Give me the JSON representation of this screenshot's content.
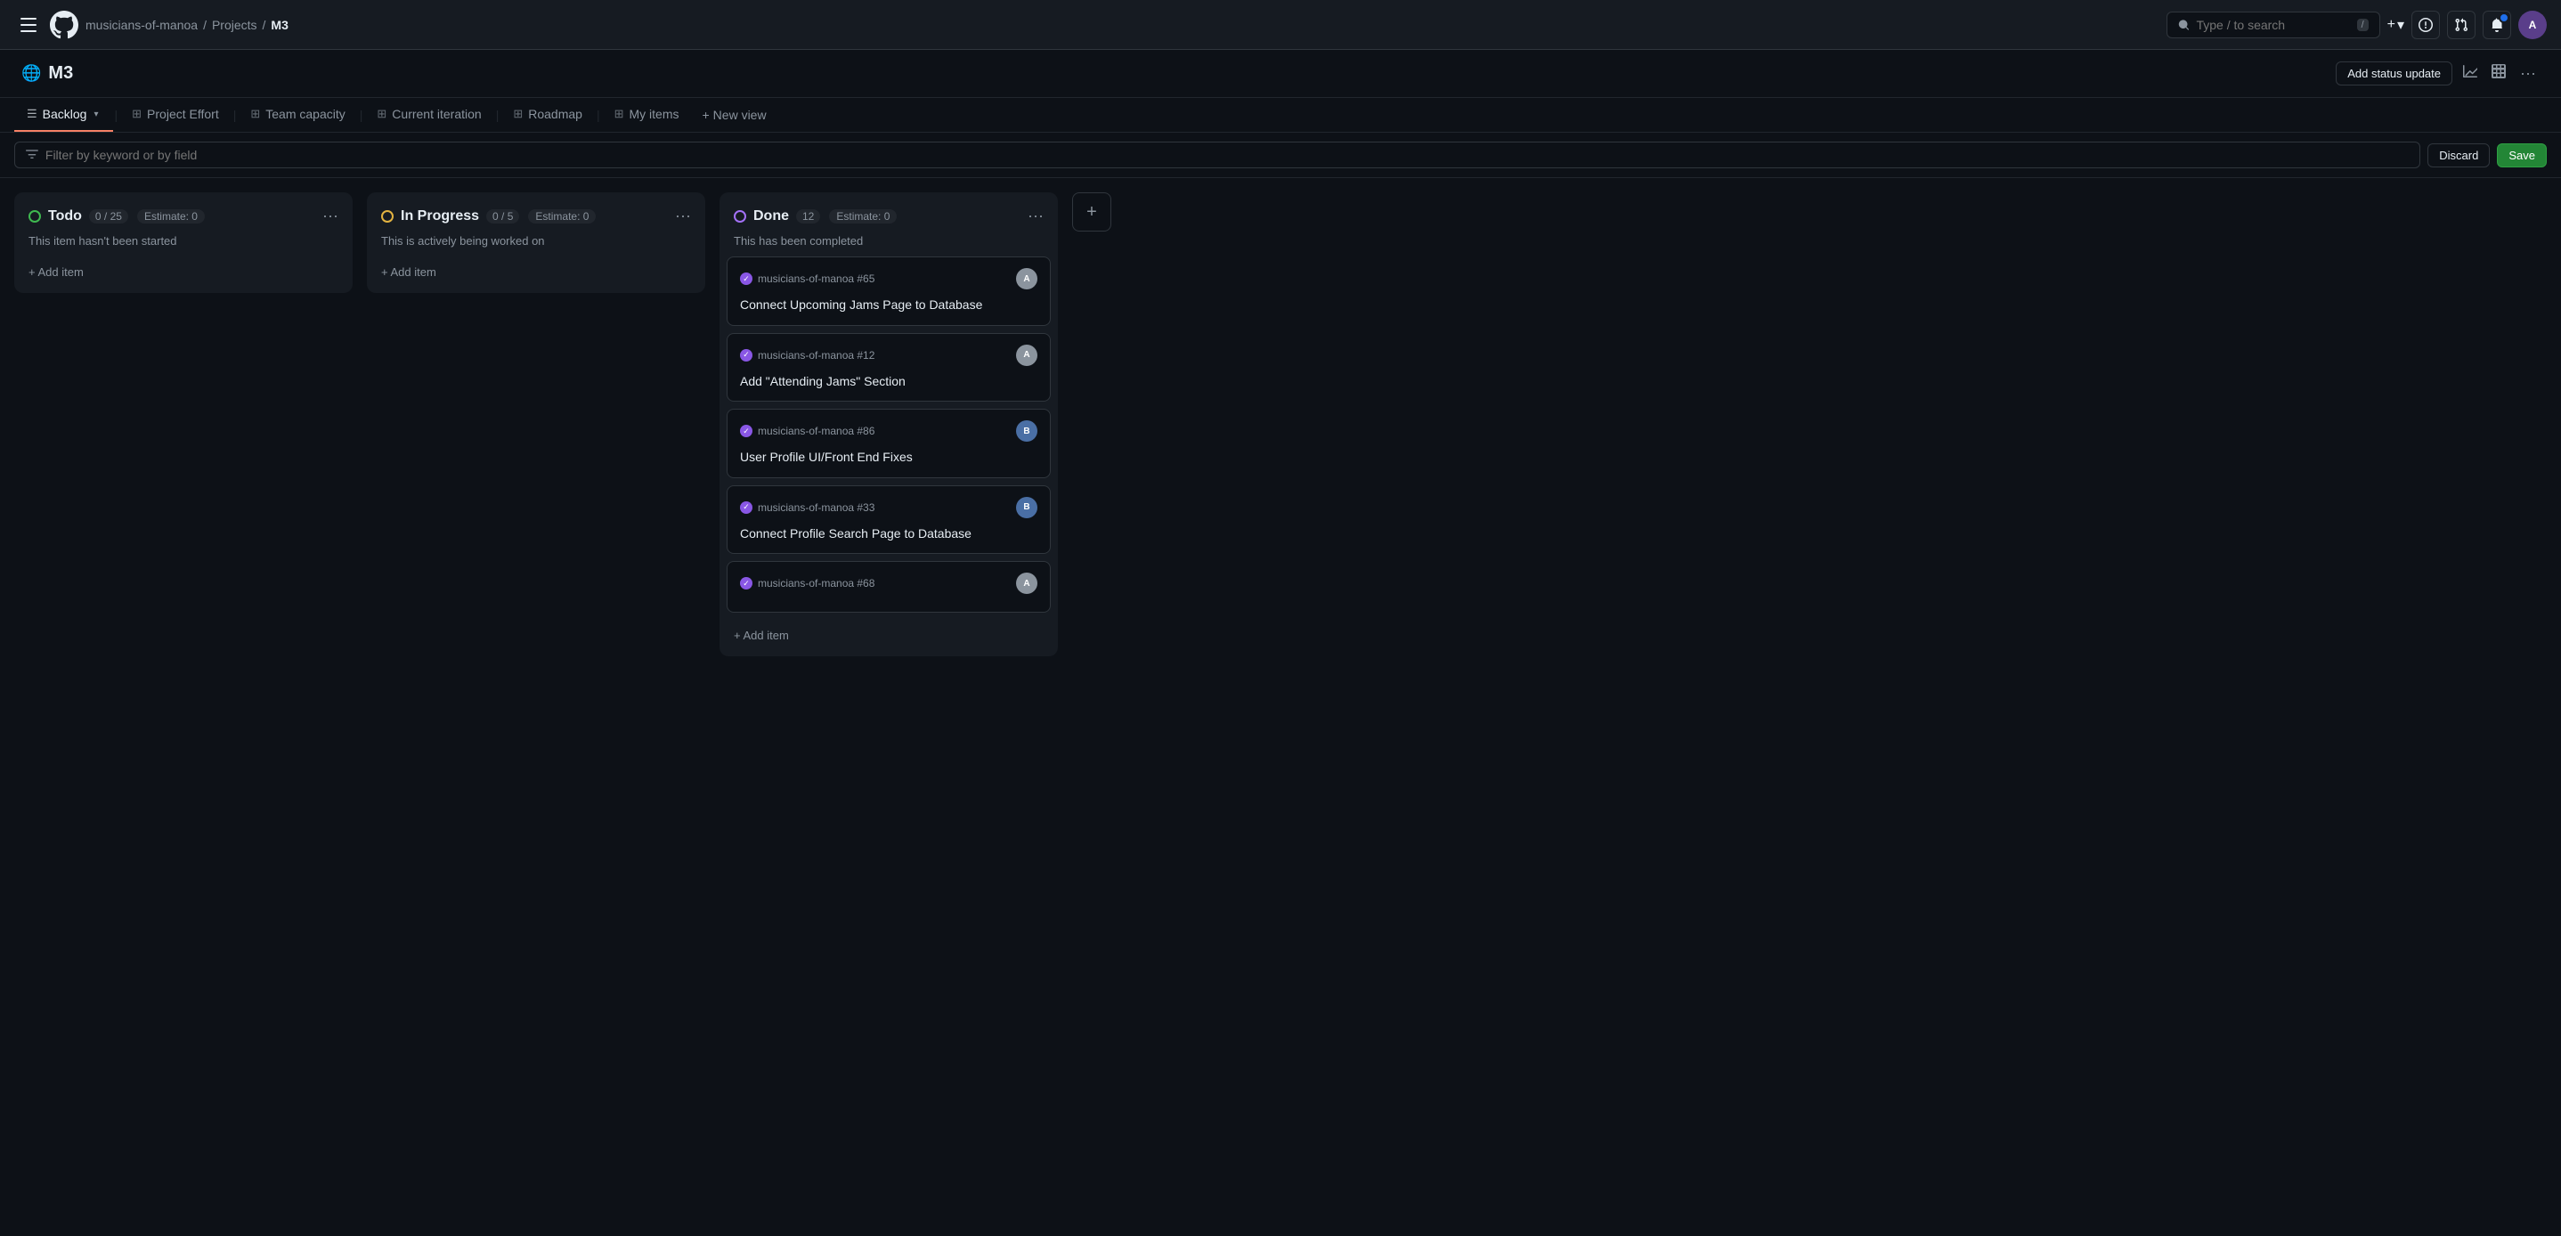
{
  "nav": {
    "breadcrumb": {
      "org": "musicians-of-manoa",
      "projects": "Projects",
      "current": "M3"
    },
    "search_placeholder": "Type / to search",
    "plus_label": "+",
    "chevron_label": "▾"
  },
  "project": {
    "title": "M3",
    "status_update_label": "Add status update"
  },
  "tabs": [
    {
      "id": "backlog",
      "label": "Backlog",
      "active": true,
      "icon": "☰"
    },
    {
      "id": "project-effort",
      "label": "Project Effort",
      "active": false,
      "icon": "⊞"
    },
    {
      "id": "team-capacity",
      "label": "Team capacity",
      "active": false,
      "icon": "⊞"
    },
    {
      "id": "current-iteration",
      "label": "Current iteration",
      "active": false,
      "icon": "⊞"
    },
    {
      "id": "roadmap",
      "label": "Roadmap",
      "active": false,
      "icon": "⊞"
    },
    {
      "id": "my-items",
      "label": "My items",
      "active": false,
      "icon": "⊞"
    }
  ],
  "new_view_label": "New view",
  "filter": {
    "placeholder": "Filter by keyword or by field",
    "discard_label": "Discard",
    "save_label": "Save"
  },
  "columns": [
    {
      "id": "todo",
      "title": "Todo",
      "status": "todo",
      "count": "0 / 25",
      "estimate": "Estimate: 0",
      "description": "This item hasn't been started",
      "cards": []
    },
    {
      "id": "in-progress",
      "title": "In Progress",
      "status": "in-progress",
      "count": "0 / 5",
      "estimate": "Estimate: 0",
      "description": "This is actively being worked on",
      "cards": []
    },
    {
      "id": "done",
      "title": "Done",
      "status": "done",
      "count": "12",
      "estimate": "Estimate: 0",
      "description": "This has been completed",
      "cards": [
        {
          "id": "card-65",
          "repo": "musicians-of-manoa #65",
          "title": "Connect Upcoming Jams Page to Database",
          "avatar_color": "#8b949e",
          "avatar_initials": "A"
        },
        {
          "id": "card-12",
          "repo": "musicians-of-manoa #12",
          "title": "Add \"Attending Jams\" Section",
          "avatar_color": "#8b949e",
          "avatar_initials": "A"
        },
        {
          "id": "card-86",
          "repo": "musicians-of-manoa #86",
          "title": "User Profile UI/Front End Fixes",
          "avatar_color": "#5a8a5a",
          "avatar_initials": "B"
        },
        {
          "id": "card-33",
          "repo": "musicians-of-manoa #33",
          "title": "Connect Profile Search Page to Database",
          "avatar_color": "#5a8a5a",
          "avatar_initials": "B"
        },
        {
          "id": "card-68",
          "repo": "musicians-of-manoa #68",
          "title": "",
          "avatar_color": "#8b949e",
          "avatar_initials": "A"
        }
      ]
    }
  ],
  "add_item_label": "+ Add item",
  "add_column_label": "+"
}
